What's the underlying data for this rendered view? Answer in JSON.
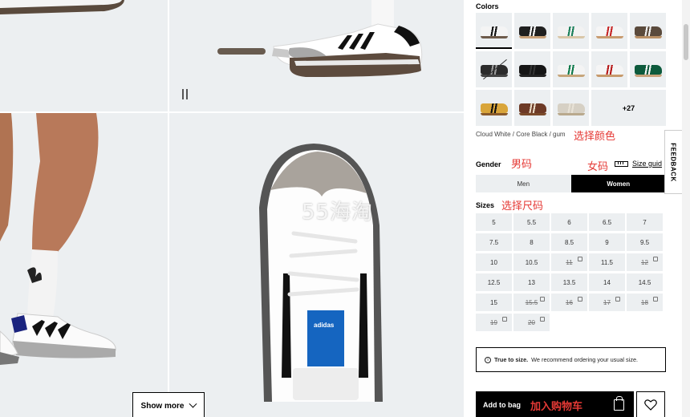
{
  "gallery": {
    "show_more_label": "Show more",
    "watermark": "55海淘",
    "insole_brand": "adidas"
  },
  "colors": {
    "label": "Colors",
    "selected_name": "Cloud White / Core Black / gum",
    "more_label": "+27",
    "swatches": [
      {
        "upper": "#f4f4f4",
        "stripe": "#111",
        "sole": "#6d5a4a"
      },
      {
        "upper": "#1f1f1f",
        "stripe": "#ffffff",
        "sole": "#c9a27a"
      },
      {
        "upper": "#f2f2f2",
        "stripe": "#1b7f5a",
        "sole": "#d9c6a8"
      },
      {
        "upper": "#f5f5f5",
        "stripe": "#c62828",
        "sole": "#c89b6f"
      },
      {
        "upper": "#5a4a3c",
        "stripe": "#f0f0f0",
        "sole": "#b99066"
      },
      {
        "upper": "#2b2b2b",
        "stripe": "#999",
        "sole": "#444"
      },
      {
        "upper": "#151515",
        "stripe": "#333",
        "sole": "#222"
      },
      {
        "upper": "#f4f4f4",
        "stripe": "#0e7a4b",
        "sole": "#c7a67c"
      },
      {
        "upper": "#f5f5f5",
        "stripe": "#b71c1c",
        "sole": "#c79a6c"
      },
      {
        "upper": "#0d5a3c",
        "stripe": "#f5f5f5",
        "sole": "#c9a27a"
      },
      {
        "upper": "#d9a53a",
        "stripe": "#111",
        "sole": "#8a5a2b"
      },
      {
        "upper": "#6d3a26",
        "stripe": "#e9d9c3",
        "sole": "#7a4a2a"
      },
      {
        "upper": "#d6d0c4",
        "stripe": "#e8e2d6",
        "sole": "#b9a98d"
      }
    ]
  },
  "gender": {
    "label": "Gender",
    "size_guide_label": "Size guid",
    "options": [
      "Men",
      "Women"
    ],
    "selected": "Women"
  },
  "sizes": {
    "label": "Sizes",
    "items": [
      {
        "v": "5",
        "oos": false
      },
      {
        "v": "5.5",
        "oos": false
      },
      {
        "v": "6",
        "oos": false
      },
      {
        "v": "6.5",
        "oos": false
      },
      {
        "v": "7",
        "oos": false
      },
      {
        "v": "7.5",
        "oos": false
      },
      {
        "v": "8",
        "oos": false
      },
      {
        "v": "8.5",
        "oos": false
      },
      {
        "v": "9",
        "oos": false
      },
      {
        "v": "9.5",
        "oos": false
      },
      {
        "v": "10",
        "oos": false
      },
      {
        "v": "10.5",
        "oos": false
      },
      {
        "v": "11",
        "oos": true
      },
      {
        "v": "11.5",
        "oos": false
      },
      {
        "v": "12",
        "oos": true
      },
      {
        "v": "12.5",
        "oos": false
      },
      {
        "v": "13",
        "oos": false
      },
      {
        "v": "13.5",
        "oos": false
      },
      {
        "v": "14",
        "oos": false
      },
      {
        "v": "14.5",
        "oos": false
      },
      {
        "v": "15",
        "oos": false
      },
      {
        "v": "15.5",
        "oos": true
      },
      {
        "v": "16",
        "oos": true
      },
      {
        "v": "17",
        "oos": true
      },
      {
        "v": "18",
        "oos": true
      },
      {
        "v": "19",
        "oos": true
      },
      {
        "v": "20",
        "oos": true
      }
    ]
  },
  "true_to_size": {
    "bold": "True to size.",
    "text": "We recommend ordering your usual size."
  },
  "cart": {
    "add_label": "Add to bag"
  },
  "feedback_label": "FEEDBACK",
  "annotations": {
    "choose_color": "选择颜色",
    "men_size": "男码",
    "women_size": "女码",
    "choose_size": "选择尺码",
    "add_to_cart": "加入购物车"
  }
}
